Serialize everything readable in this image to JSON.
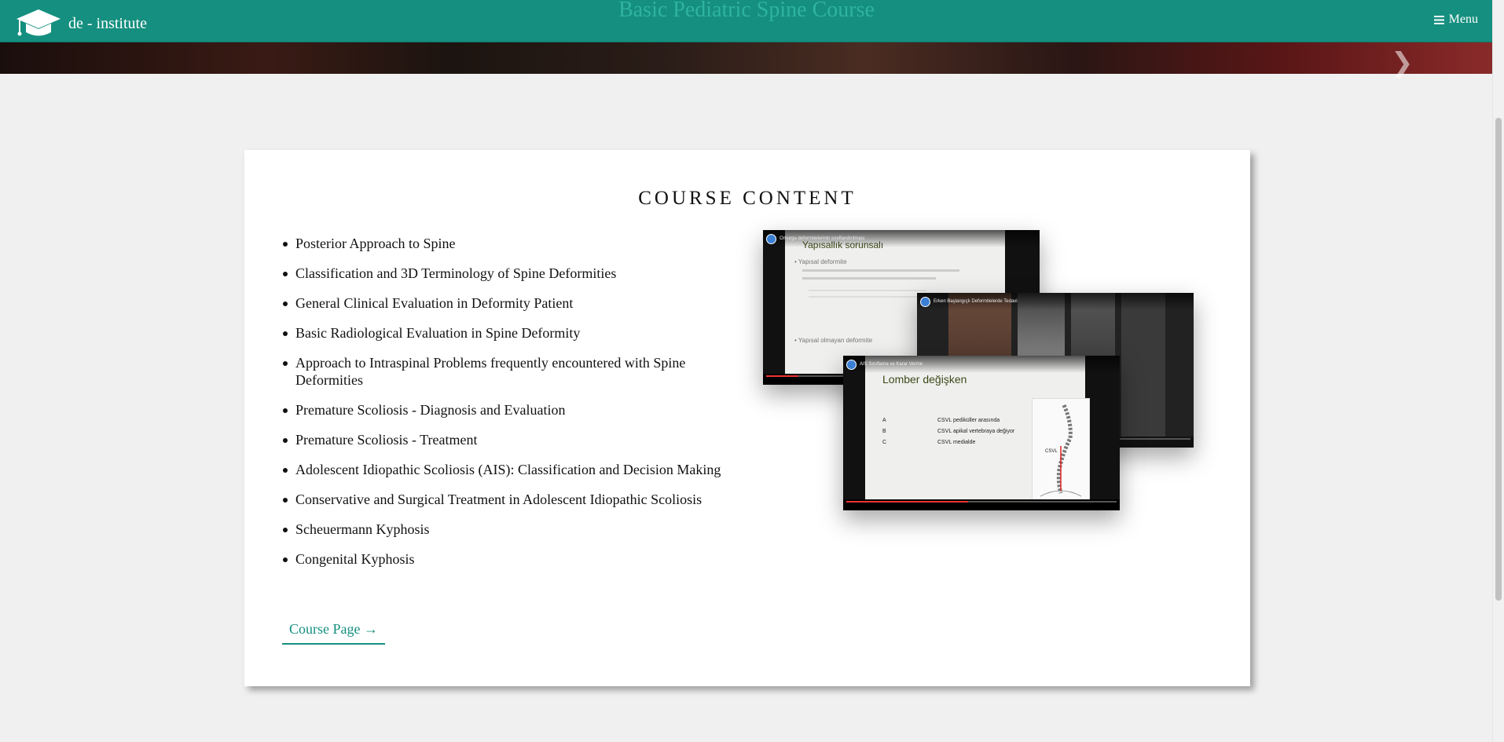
{
  "navbar": {
    "brand": "de - institute",
    "hero_title": "Basic Pediatric Spine Course",
    "menu_label": "Menu",
    "color": "#158f7f"
  },
  "course": {
    "heading": "COURSE CONTENT",
    "topics": [
      "Posterior Approach to Spine",
      "Classification and 3D Terminology of Spine Deformities",
      "General Clinical Evaluation in Deformity Patient",
      "Basic Radiological Evaluation in Spine Deformity",
      "Approach to Intraspinal Problems frequently encountered with Spine Deformities",
      "Premature Scoliosis - Diagnosis and Evaluation",
      "Premature Scoliosis - Treatment",
      "Adolescent Idiopathic Scoliosis (AIS): Classification and Decision Making",
      "Conservative and Surgical Treatment in Adolescent Idiopathic Scoliosis",
      "Scheuermann Kyphosis",
      "Congenital Kyphosis"
    ],
    "link_label": "Course Page →"
  },
  "videos": [
    {
      "title": "Omurga deformitelerinin sınıflandırılması",
      "slide_title": "Yapısallık sorunsalı",
      "bullets": [
        "Yapısal deformite",
        "Yapısal olmayan deformite"
      ],
      "progress": 0.12
    },
    {
      "title": "Erken Başlangıçlı Deformitelerde Tedavi",
      "progress": 0.0
    },
    {
      "title": "AIS Sınıflama ve Karar Verme",
      "slide_title": "Lomber değişken",
      "rows": [
        {
          "key": "A",
          "text": "CSVL pediküller arasında"
        },
        {
          "key": "B",
          "text": "CSVL apikal vertebraya değiyor"
        },
        {
          "key": "C",
          "text": "CSVL medialde"
        }
      ],
      "xray_label": "CSVL",
      "progress": 0.45
    }
  ]
}
